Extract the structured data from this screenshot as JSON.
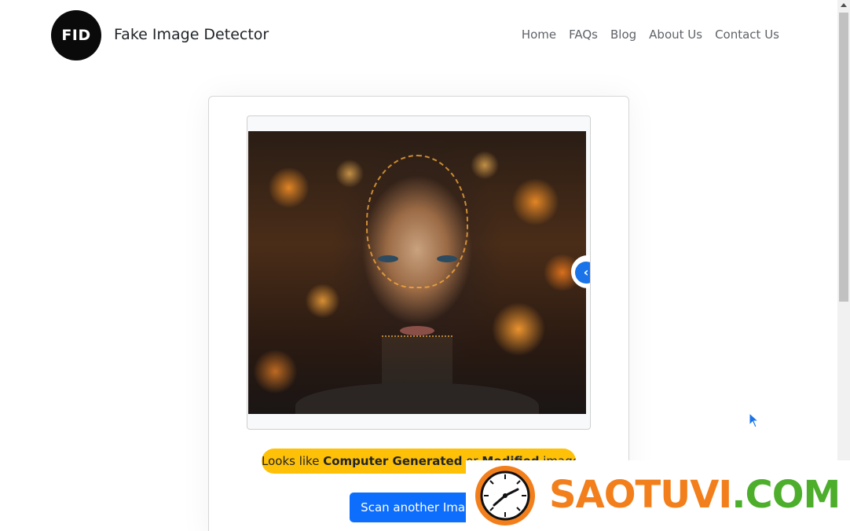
{
  "header": {
    "logo_text": "FID",
    "brand": "Fake Image Detector",
    "nav": [
      "Home",
      "FAQs",
      "Blog",
      "About Us",
      "Contact Us"
    ]
  },
  "result": {
    "prefix": "Looks like ",
    "strong1": "Computer Generated",
    "middle": " or ",
    "strong2": "Modified",
    "suffix": " image"
  },
  "actions": {
    "scan_another": "Scan another Image"
  },
  "watermark": {
    "part1": "SAOTUVI",
    "part2": ".COM"
  },
  "colors": {
    "badge": "#ffc107",
    "primary_button": "#0d6efd",
    "compare_handle": "#1a73e8",
    "watermark_orange": "#f27f1b",
    "watermark_green": "#4cae2b"
  },
  "icons": {
    "compare_handle": "chevron-left-icon",
    "cursor": "mouse-pointer-icon",
    "watermark_logo": "clock-icon"
  }
}
